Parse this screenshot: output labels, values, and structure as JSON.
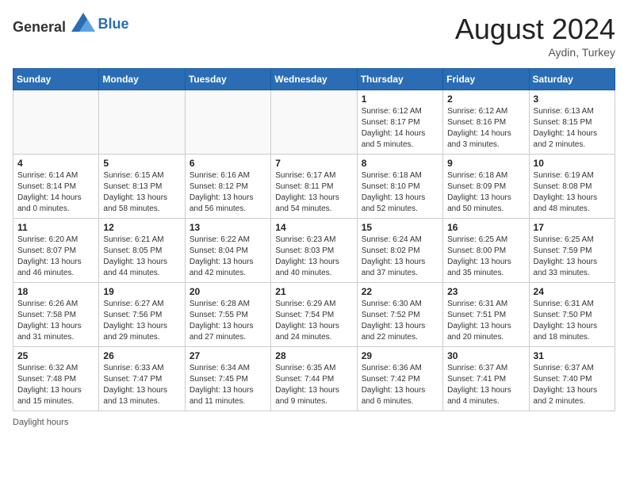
{
  "header": {
    "logo_general": "General",
    "logo_blue": "Blue",
    "month_year": "August 2024",
    "location": "Aydin, Turkey"
  },
  "footer": {
    "daylight_label": "Daylight hours"
  },
  "days_of_week": [
    "Sunday",
    "Monday",
    "Tuesday",
    "Wednesday",
    "Thursday",
    "Friday",
    "Saturday"
  ],
  "weeks": [
    [
      {
        "day": "",
        "info": ""
      },
      {
        "day": "",
        "info": ""
      },
      {
        "day": "",
        "info": ""
      },
      {
        "day": "",
        "info": ""
      },
      {
        "day": "1",
        "info": "Sunrise: 6:12 AM\nSunset: 8:17 PM\nDaylight: 14 hours and 5 minutes."
      },
      {
        "day": "2",
        "info": "Sunrise: 6:12 AM\nSunset: 8:16 PM\nDaylight: 14 hours and 3 minutes."
      },
      {
        "day": "3",
        "info": "Sunrise: 6:13 AM\nSunset: 8:15 PM\nDaylight: 14 hours and 2 minutes."
      }
    ],
    [
      {
        "day": "4",
        "info": "Sunrise: 6:14 AM\nSunset: 8:14 PM\nDaylight: 14 hours and 0 minutes."
      },
      {
        "day": "5",
        "info": "Sunrise: 6:15 AM\nSunset: 8:13 PM\nDaylight: 13 hours and 58 minutes."
      },
      {
        "day": "6",
        "info": "Sunrise: 6:16 AM\nSunset: 8:12 PM\nDaylight: 13 hours and 56 minutes."
      },
      {
        "day": "7",
        "info": "Sunrise: 6:17 AM\nSunset: 8:11 PM\nDaylight: 13 hours and 54 minutes."
      },
      {
        "day": "8",
        "info": "Sunrise: 6:18 AM\nSunset: 8:10 PM\nDaylight: 13 hours and 52 minutes."
      },
      {
        "day": "9",
        "info": "Sunrise: 6:18 AM\nSunset: 8:09 PM\nDaylight: 13 hours and 50 minutes."
      },
      {
        "day": "10",
        "info": "Sunrise: 6:19 AM\nSunset: 8:08 PM\nDaylight: 13 hours and 48 minutes."
      }
    ],
    [
      {
        "day": "11",
        "info": "Sunrise: 6:20 AM\nSunset: 8:07 PM\nDaylight: 13 hours and 46 minutes."
      },
      {
        "day": "12",
        "info": "Sunrise: 6:21 AM\nSunset: 8:05 PM\nDaylight: 13 hours and 44 minutes."
      },
      {
        "day": "13",
        "info": "Sunrise: 6:22 AM\nSunset: 8:04 PM\nDaylight: 13 hours and 42 minutes."
      },
      {
        "day": "14",
        "info": "Sunrise: 6:23 AM\nSunset: 8:03 PM\nDaylight: 13 hours and 40 minutes."
      },
      {
        "day": "15",
        "info": "Sunrise: 6:24 AM\nSunset: 8:02 PM\nDaylight: 13 hours and 37 minutes."
      },
      {
        "day": "16",
        "info": "Sunrise: 6:25 AM\nSunset: 8:00 PM\nDaylight: 13 hours and 35 minutes."
      },
      {
        "day": "17",
        "info": "Sunrise: 6:25 AM\nSunset: 7:59 PM\nDaylight: 13 hours and 33 minutes."
      }
    ],
    [
      {
        "day": "18",
        "info": "Sunrise: 6:26 AM\nSunset: 7:58 PM\nDaylight: 13 hours and 31 minutes."
      },
      {
        "day": "19",
        "info": "Sunrise: 6:27 AM\nSunset: 7:56 PM\nDaylight: 13 hours and 29 minutes."
      },
      {
        "day": "20",
        "info": "Sunrise: 6:28 AM\nSunset: 7:55 PM\nDaylight: 13 hours and 27 minutes."
      },
      {
        "day": "21",
        "info": "Sunrise: 6:29 AM\nSunset: 7:54 PM\nDaylight: 13 hours and 24 minutes."
      },
      {
        "day": "22",
        "info": "Sunrise: 6:30 AM\nSunset: 7:52 PM\nDaylight: 13 hours and 22 minutes."
      },
      {
        "day": "23",
        "info": "Sunrise: 6:31 AM\nSunset: 7:51 PM\nDaylight: 13 hours and 20 minutes."
      },
      {
        "day": "24",
        "info": "Sunrise: 6:31 AM\nSunset: 7:50 PM\nDaylight: 13 hours and 18 minutes."
      }
    ],
    [
      {
        "day": "25",
        "info": "Sunrise: 6:32 AM\nSunset: 7:48 PM\nDaylight: 13 hours and 15 minutes."
      },
      {
        "day": "26",
        "info": "Sunrise: 6:33 AM\nSunset: 7:47 PM\nDaylight: 13 hours and 13 minutes."
      },
      {
        "day": "27",
        "info": "Sunrise: 6:34 AM\nSunset: 7:45 PM\nDaylight: 13 hours and 11 minutes."
      },
      {
        "day": "28",
        "info": "Sunrise: 6:35 AM\nSunset: 7:44 PM\nDaylight: 13 hours and 9 minutes."
      },
      {
        "day": "29",
        "info": "Sunrise: 6:36 AM\nSunset: 7:42 PM\nDaylight: 13 hours and 6 minutes."
      },
      {
        "day": "30",
        "info": "Sunrise: 6:37 AM\nSunset: 7:41 PM\nDaylight: 13 hours and 4 minutes."
      },
      {
        "day": "31",
        "info": "Sunrise: 6:37 AM\nSunset: 7:40 PM\nDaylight: 13 hours and 2 minutes."
      }
    ]
  ]
}
